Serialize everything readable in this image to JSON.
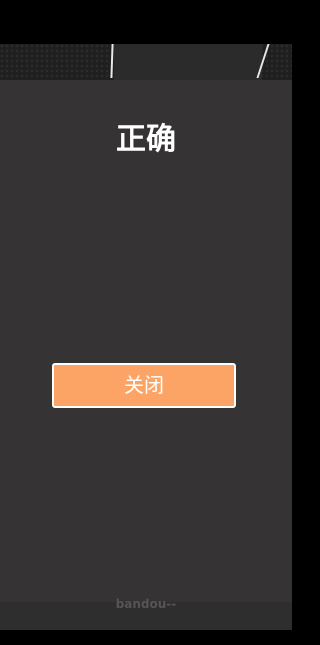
{
  "modal": {
    "title": "正确",
    "close_label": "关闭"
  },
  "footer": {
    "text": "bandou--"
  },
  "colors": {
    "modal_background": "#353333",
    "button_background": "#fca466",
    "button_border": "#ffffff",
    "title_text": "#ffffff"
  }
}
